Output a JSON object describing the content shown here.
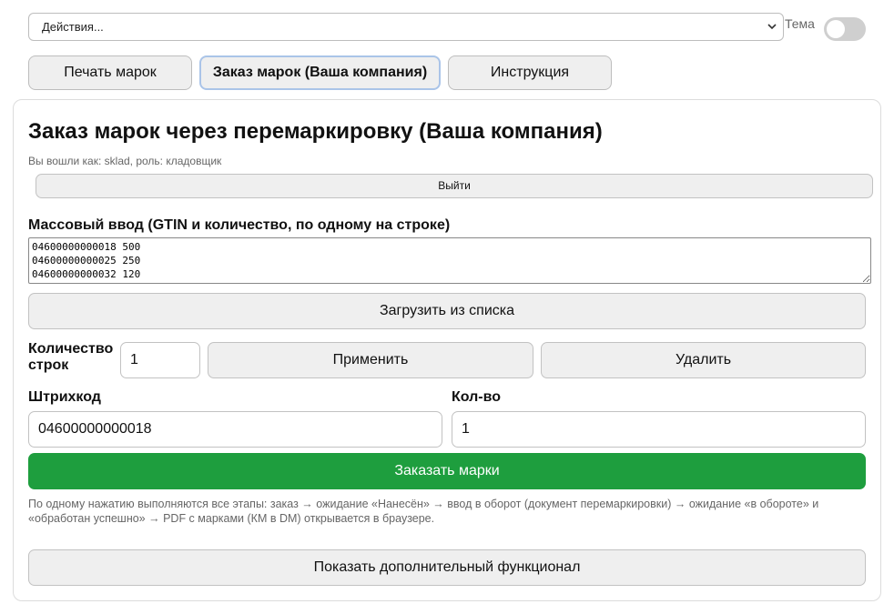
{
  "actions_select": {
    "value": "Действия..."
  },
  "theme": {
    "label": "Тема"
  },
  "tabs": [
    {
      "label": "Печать марок"
    },
    {
      "label": "Заказ марок (Ваша компания)"
    },
    {
      "label": "Инструкция"
    }
  ],
  "page": {
    "title": "Заказ марок через перемаркировку (Ваша компания)",
    "login_info": "Вы вошли как: sklad, роль: кладовщик",
    "logout_label": "Выйти"
  },
  "bulk": {
    "label": "Массовый ввод (GTIN и количество, по одному на строке)",
    "value": "04600000000018 500\n04600000000025 250\n04600000000032 120",
    "load_label": "Загрузить из списка"
  },
  "rows": {
    "label": "Количество строк",
    "value": "1",
    "apply_label": "Применить",
    "delete_label": "Удалить"
  },
  "form": {
    "barcode_label": "Штрихкод",
    "barcode_value": "04600000000018",
    "qty_label": "Кол-во",
    "qty_value": "1",
    "order_label": "Заказать марки"
  },
  "note": "По одному нажатию выполняются все этапы: заказ → ожидание «Нанесён» → ввод в оборот (документ перемаркировки) → ожидание «в обороте» и «обработан успешно» → PDF с марками (КМ в DM) открывается в браузере.",
  "extra": {
    "label": "Показать дополнительный функционал"
  },
  "colors": {
    "accent_green": "#1e9e3e",
    "active_tab_border": "#aac4e8"
  }
}
